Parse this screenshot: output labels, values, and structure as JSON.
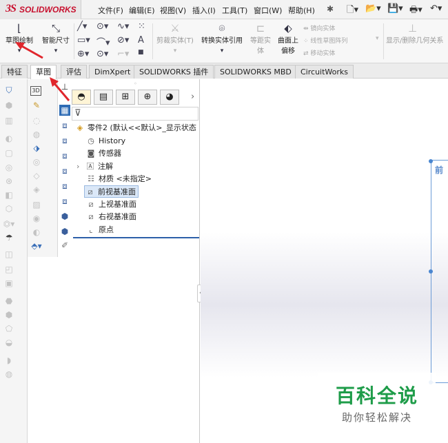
{
  "app": {
    "logo_ds": "3S",
    "logo_text": "SOLIDWORKS"
  },
  "menu": [
    "文件(F)",
    "编辑(E)",
    "视图(V)",
    "插入(I)",
    "工具(T)",
    "窗口(W)",
    "帮助(H)"
  ],
  "ribbon": {
    "sketch_label": "草图绘制",
    "smart_dim_label": "智能尺寸",
    "trim_label": "剪裁实体(T)",
    "convert_label": "转换实体引用",
    "offset_label_1": "等距实",
    "offset_label_2": "体",
    "surface_label_1": "曲面上",
    "surface_label_2": "偏移",
    "mirror_label": "镜向实体",
    "linear_pattern_label": "线性草图阵列",
    "move_label": "移动实体",
    "display_delete_label": "显示/删除几何关系"
  },
  "tabs": [
    "特征",
    "草图",
    "评估",
    "DimXpert",
    "SOLIDWORKS 插件",
    "SOLIDWORKS MBD",
    "CircuitWorks"
  ],
  "active_tab": "草图",
  "feature_tree": {
    "root": "零件2 (默认<<默认>_显示状态",
    "items": [
      "History",
      "传感器",
      "注解",
      "材质 <未指定>",
      "前视基准面",
      "上视基准面",
      "右视基准面",
      "原点"
    ],
    "selected": "前视基准面"
  },
  "graphics": {
    "plane_label": "前"
  },
  "watermark": {
    "title": "百科全说",
    "subtitle": "助你轻松解决"
  },
  "colors": {
    "accent_red": "#c8102e",
    "selection_blue": "#dbe8f8",
    "plane_blue": "#6b9bd6",
    "watermark_green": "#1e9c49"
  }
}
